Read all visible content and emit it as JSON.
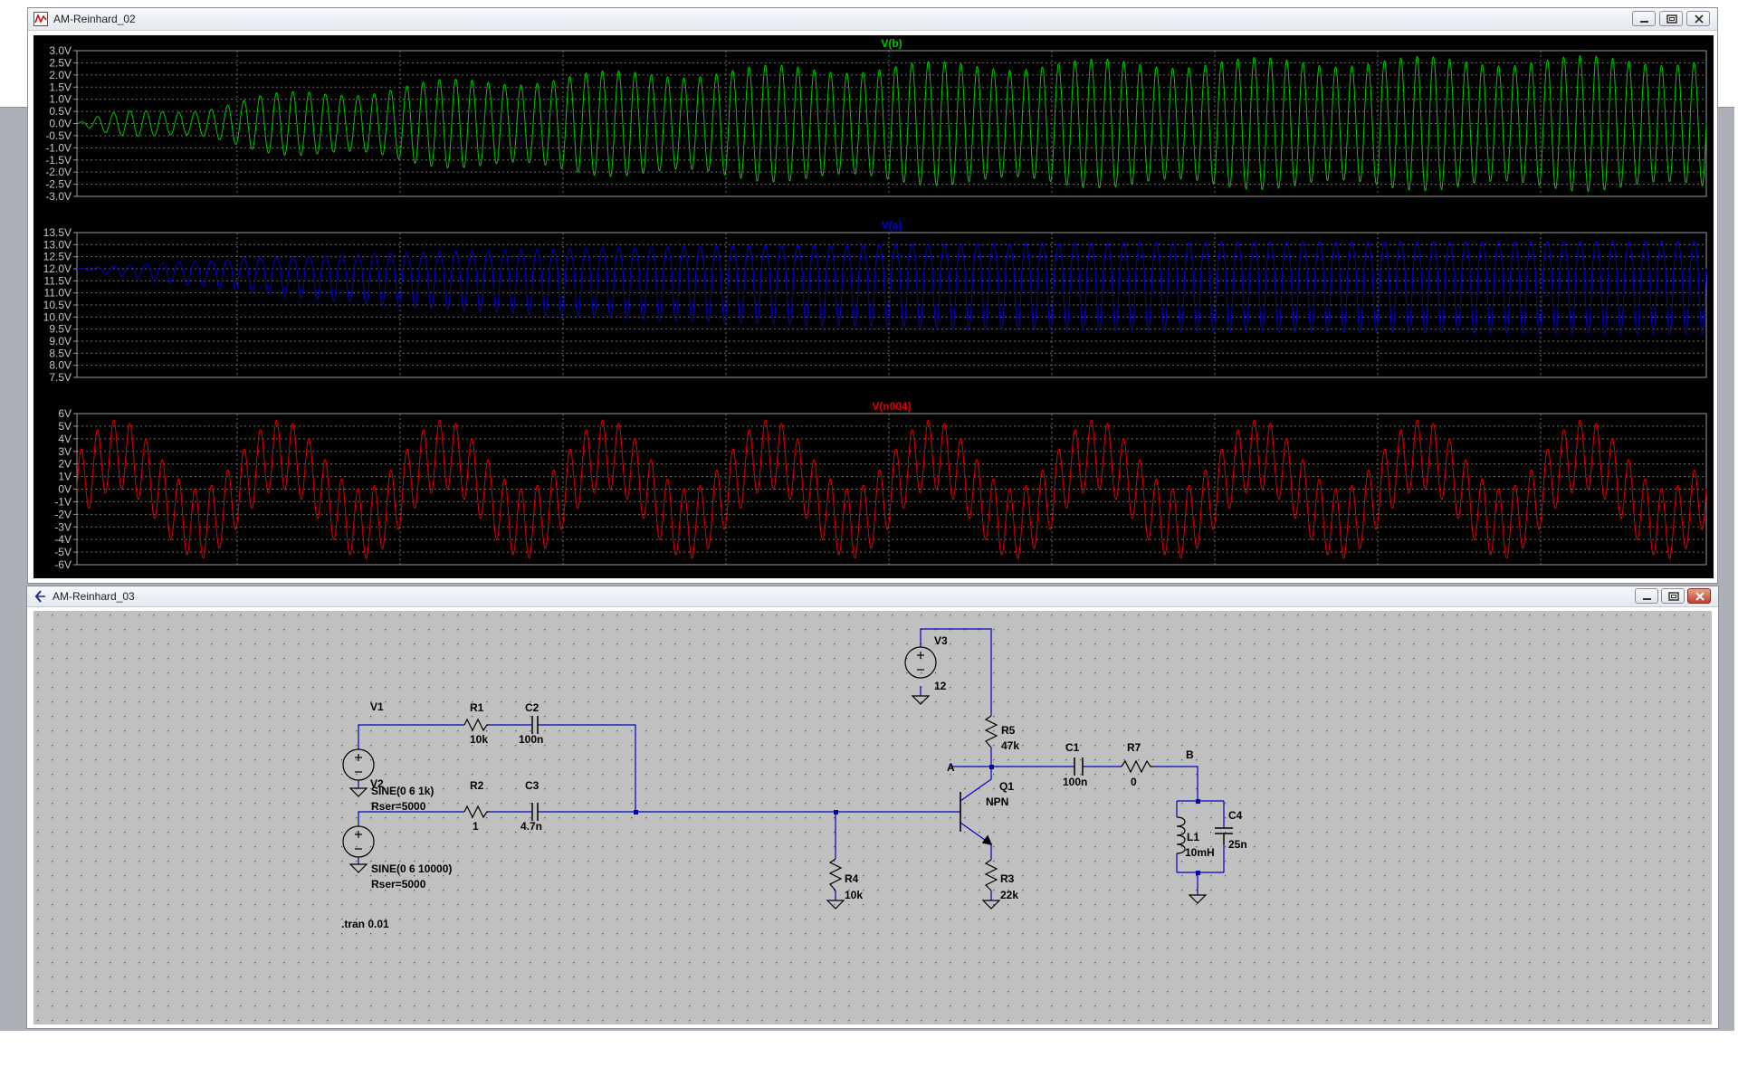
{
  "plot_window": {
    "title": "AM-Reinhard_02",
    "panes": [
      {
        "trace": "V(b)",
        "color": "#00c800",
        "y_labels": [
          "3.0V",
          "2.5V",
          "2.0V",
          "1.5V",
          "1.0V",
          "0.5V",
          "0.0V",
          "-0.5V",
          "-1.0V",
          "-1.5V",
          "-2.0V",
          "-2.5V",
          "-3.0V"
        ]
      },
      {
        "trace": "V(a)",
        "color": "#0000e0",
        "y_labels": [
          "13.5V",
          "13.0V",
          "12.5V",
          "12.0V",
          "11.5V",
          "11.0V",
          "10.5V",
          "10.0V",
          "9.5V",
          "9.0V",
          "8.5V",
          "8.0V",
          "7.5V"
        ]
      },
      {
        "trace": "V(n004)",
        "color": "#e00000",
        "y_labels": [
          "6V",
          "5V",
          "4V",
          "3V",
          "2V",
          "1V",
          "0V",
          "-1V",
          "-2V",
          "-3V",
          "-4V",
          "-5V",
          "-6V"
        ]
      }
    ]
  },
  "schematic_window": {
    "title": "AM-Reinhard_03",
    "wire_color": "#0000c0",
    "components": {
      "V1": {
        "name": "V1",
        "value": "SINE(0 6 1k)",
        "rser": "Rser=5000"
      },
      "V2": {
        "name": "V2",
        "value": "SINE(0 6 10000)",
        "rser": "Rser=5000"
      },
      "V3": {
        "name": "V3",
        "value": "12"
      },
      "R1": {
        "name": "R1",
        "value": "10k"
      },
      "R2": {
        "name": "R2",
        "value": "1"
      },
      "R3": {
        "name": "R3",
        "value": "22k"
      },
      "R4": {
        "name": "R4",
        "value": "10k"
      },
      "R5": {
        "name": "R5",
        "value": "47k"
      },
      "R7": {
        "name": "R7",
        "value": "0"
      },
      "C1": {
        "name": "C1",
        "value": "100n"
      },
      "C2": {
        "name": "C2",
        "value": "100n"
      },
      "C3": {
        "name": "C3",
        "value": "4.7n"
      },
      "C4": {
        "name": "C4",
        "value": "25n"
      },
      "L1": {
        "name": "L1",
        "value": "10mH"
      },
      "Q1": {
        "name": "Q1",
        "value": "NPN"
      }
    },
    "net_labels": {
      "a": "A",
      "b": "B"
    },
    "directive": ".tran 0.01"
  }
}
